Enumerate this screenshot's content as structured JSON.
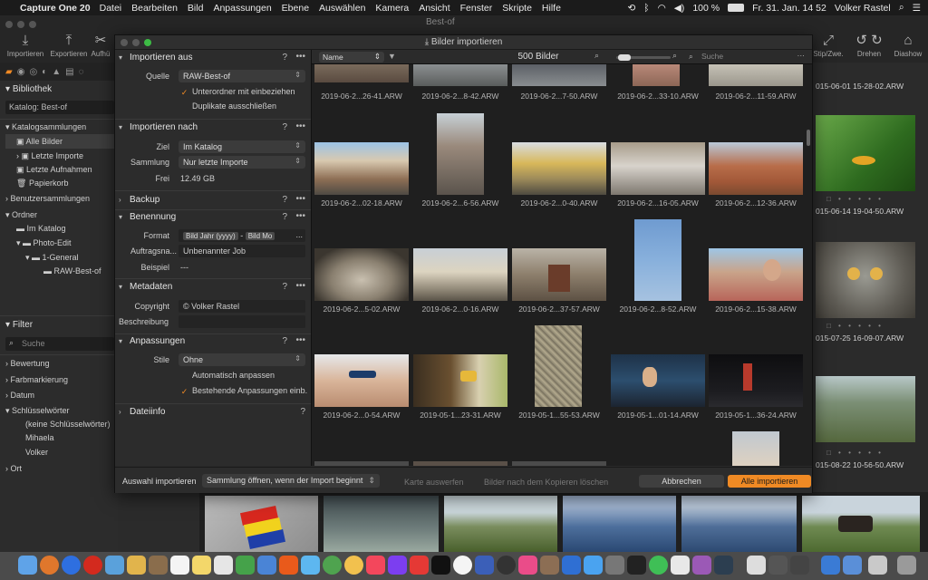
{
  "menubar": {
    "app": "Capture One 20",
    "items": [
      "Datei",
      "Bearbeiten",
      "Bild",
      "Anpassungen",
      "Ebene",
      "Auswählen",
      "Kamera",
      "Ansicht",
      "Fenster",
      "Skripte",
      "Hilfe"
    ],
    "battery": "100 %",
    "datetime": "Fr. 31. Jan. 14 52",
    "user": "Volker Rastel"
  },
  "toolbar": {
    "import_label": "Importieren",
    "export_label": "Exportieren",
    "cut_label": "Aufhü",
    "window_title": "Best-of",
    "rotate_label": "Drehen",
    "slideshow_label": "Diashow",
    "zoom_label": "Stip/Zwe."
  },
  "library": {
    "title": "Bibliothek",
    "catalog": "Katalog: Best-of",
    "catalog_collections": "Katalogsammlungen",
    "collections": [
      "Alle Bilder",
      "Letzte Importe",
      "Letzte Aufnahmen",
      "Papierkorb"
    ],
    "user_collections": "Benutzersammlungen",
    "folders_title": "Ordner",
    "folders": [
      "Im Katalog",
      "Photo-Edit",
      "1-General",
      "RAW-Best-of"
    ]
  },
  "filter": {
    "title": "Filter",
    "search_placeholder": "Suche",
    "sections": [
      "Bewertung",
      "Farbmarkierung",
      "Datum",
      "Schlüsselwörter"
    ],
    "keywords": [
      "(keine Schlüsselwörter)",
      "Mihaela",
      "Volker"
    ],
    "location": "Ort"
  },
  "browser_right": {
    "labels": [
      "015-06-01 15-28-02.ARW",
      "015-06-14 19-04-50.ARW",
      "015-07-25 16-09-07.ARW",
      "015-08-22 10-56-50.ARW"
    ],
    "dots": "□ • • • • •"
  },
  "dialog": {
    "title": "Bilder importieren",
    "import_from": {
      "title": "Importieren aus",
      "source_label": "Quelle",
      "source_value": "RAW-Best-of",
      "include_subfolders": "Unterordner mit einbeziehen",
      "exclude_duplicates": "Duplikate ausschließen"
    },
    "import_to": {
      "title": "Importieren nach",
      "target_label": "Ziel",
      "target_value": "Im Katalog",
      "collection_label": "Sammlung",
      "collection_value": "Nur letzte Importe",
      "free_label": "Frei",
      "free_value": "12.49 GB"
    },
    "backup": "Backup",
    "naming": {
      "title": "Benennung",
      "format_label": "Format",
      "token1": "Bild Jahr (yyyy)",
      "token2": "Bild Mo",
      "job_label": "Auftragsna...",
      "job_value": "Unbenannter Job",
      "example_label": "Beispiel",
      "example_value": "---"
    },
    "metadata": {
      "title": "Metadaten",
      "copyright_label": "Copyright",
      "copyright_value": "© Volker Rastel",
      "description_label": "Beschreibung"
    },
    "adjustments": {
      "title": "Anpassungen",
      "styles_label": "Stile",
      "styles_value": "Ohne",
      "auto_adjust": "Automatisch anpassen",
      "existing": "Bestehende Anpassungen einb."
    },
    "fileinfo": "Dateiinfo",
    "help": "?",
    "more": "•••",
    "sort_value": "Name",
    "count": "500 Bilder",
    "search_placeholder": "Suche",
    "thumb_labels": {
      "row0": [
        "2019-06-2...26-41.ARW",
        "2019-06-2...8-42.ARW",
        "2019-06-2...7-50.ARW",
        "2019-06-2...33-10.ARW",
        "2019-06-2...11-59.ARW"
      ],
      "row1": [
        "2019-06-2...02-18.ARW",
        "2019-06-2...6-56.ARW",
        "2019-06-2...0-40.ARW",
        "2019-06-2...16-05.ARW",
        "2019-06-2...12-36.ARW"
      ],
      "row2": [
        "2019-06-2...5-02.ARW",
        "2019-06-2...0-16.ARW",
        "2019-06-2...37-57.ARW",
        "2019-06-2...8-52.ARW",
        "2019-06-2...15-38.ARW"
      ],
      "row3": [
        "2019-06-2...0-54.ARW",
        "2019-05-1...23-31.ARW",
        "2019-05-1...55-53.ARW",
        "2019-05-1...01-14.ARW",
        "2019-05-1...36-24.ARW"
      ]
    },
    "footer": {
      "select_label": "Auswahl importieren",
      "after_import": "Sammlung öffnen, wenn der Import beginnt",
      "eject": "Karte auswerfen",
      "delete_after": "Bilder nach dem Kopieren löschen",
      "cancel": "Abbrechen",
      "import_all": "Alle importieren"
    }
  },
  "colors": {
    "accent": "#f08a24",
    "panel": "#2c2c2c",
    "grid_bg": "#1f1f1f"
  }
}
